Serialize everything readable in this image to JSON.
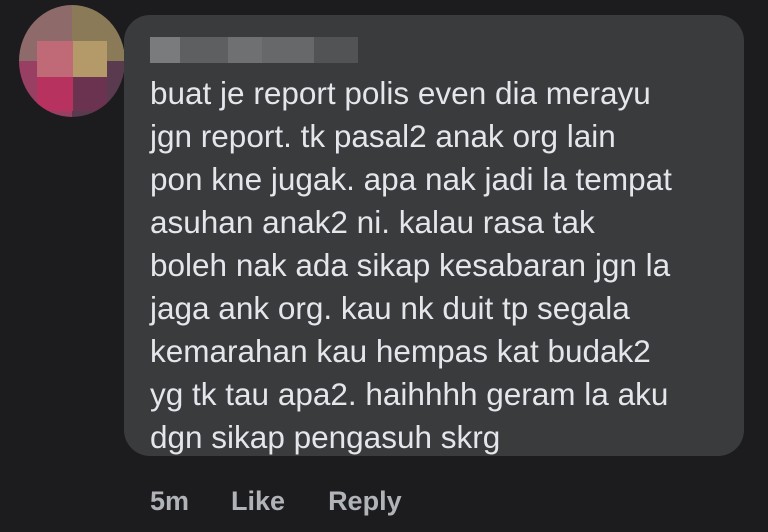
{
  "comment": {
    "author_avatar": "blurred-avatar",
    "author_name": "",
    "text": "buat je report polis even dia merayu\njgn report. tk pasal2 anak org lain\npon kne jugak. apa nak jadi la tempat\nasuhan anak2 ni. kalau rasa tak\nboleh nak ada sikap kesabaran jgn la\njaga ank org. kau nk duit tp segala\nkemarahan kau hempas kat budak2\nyg tk tau apa2. haihhhh geram la aku\ndgn sikap pengasuh skrg",
    "timestamp": "5m",
    "like_label": "Like",
    "reply_label": "Reply"
  },
  "colors": {
    "background": "#1c1c1e",
    "bubble": "#3a3b3c",
    "text": "#e4e6eb",
    "meta": "#b0b3b8"
  }
}
